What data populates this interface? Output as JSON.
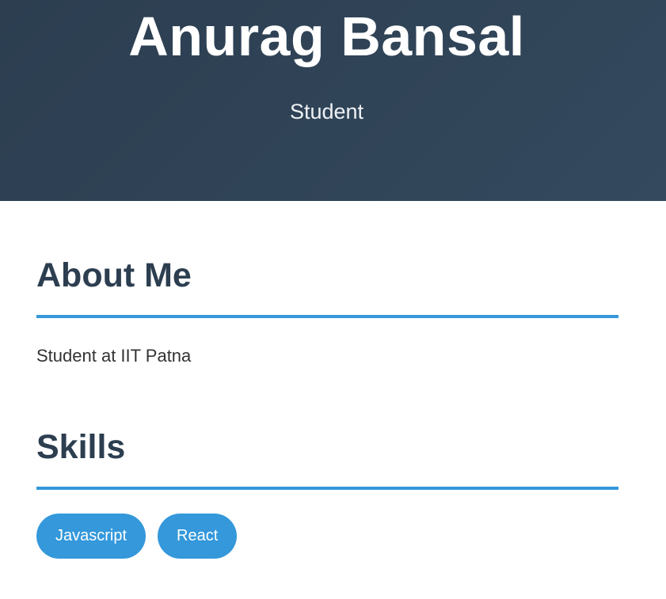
{
  "header": {
    "name": "Anurag Bansal",
    "role": "Student"
  },
  "about": {
    "title": "About Me",
    "text": "Student at IIT Patna"
  },
  "skills": {
    "title": "Skills",
    "items": [
      "Javascript",
      "React"
    ]
  },
  "colors": {
    "header_bg": "#2c3e50",
    "accent": "#3498db",
    "heading": "#2c3e50",
    "body_text": "#333333"
  }
}
